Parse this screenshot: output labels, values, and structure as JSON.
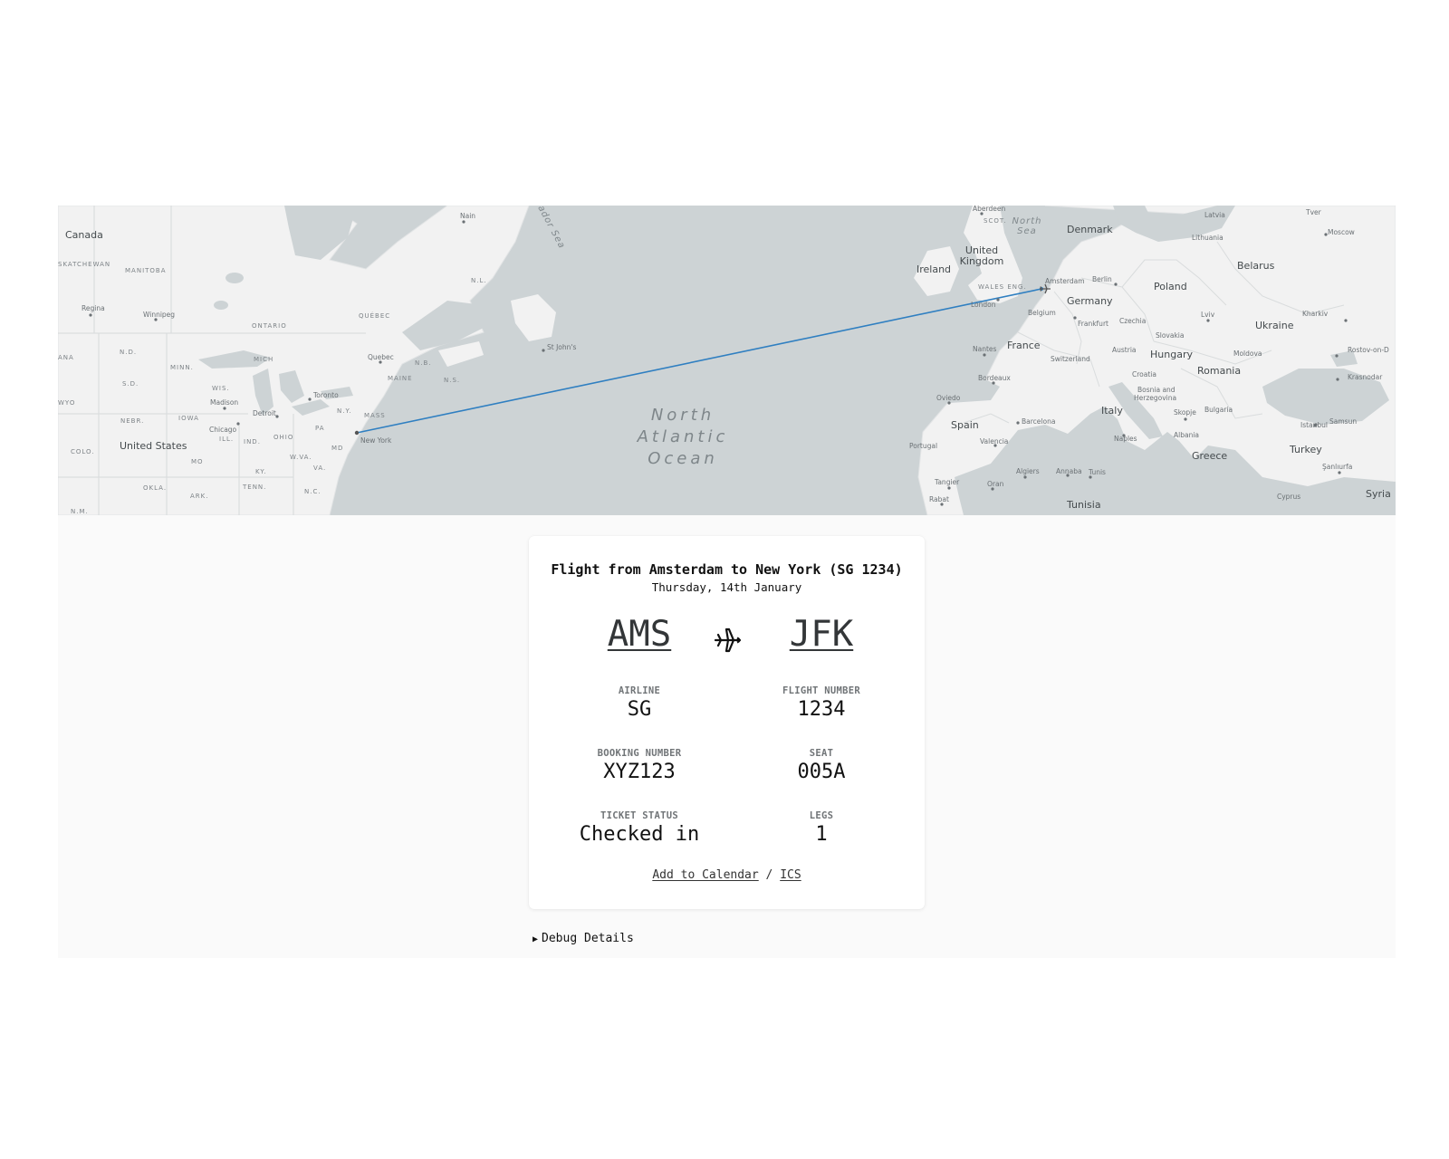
{
  "map": {
    "countries": {
      "canada": "Canada",
      "united_states": "United States",
      "united_kingdom_line1": "United",
      "united_kingdom_line2": "Kingdom",
      "ireland": "Ireland",
      "denmark": "Denmark",
      "latvia": "Latvia",
      "lithuania": "Lithuania",
      "belarus": "Belarus",
      "poland": "Poland",
      "germany": "Germany",
      "belgium": "Belgium",
      "czechia": "Czechia",
      "slovakia": "Slovakia",
      "ukraine": "Ukraine",
      "moldova": "Moldova",
      "france": "France",
      "switzerland": "Switzerland",
      "austria": "Austria",
      "hungary": "Hungary",
      "romania": "Romania",
      "croatia": "Croatia",
      "bosnia_line1": "Bosnia and",
      "bosnia_line2": "Herzegovina",
      "italy": "Italy",
      "bulgaria": "Bulgaria",
      "albania": "Albania",
      "greece": "Greece",
      "turkey": "Turkey",
      "spain": "Spain",
      "portugal": "Portugal",
      "tunisia": "Tunisia",
      "syria": "Syria",
      "cyprus": "Cyprus"
    },
    "regions": {
      "saskatchewan": "SKATCHEWAN",
      "manitoba": "MANITOBA",
      "ontario": "ONTARIO",
      "quebec": "QUÉBEC",
      "nl": "N.L.",
      "nb": "N.B.",
      "ns": "N.S.",
      "maine": "MAINE",
      "nd": "N.D.",
      "minn": "MINN.",
      "sd": "S.D.",
      "wis": "WIS.",
      "mich": "MICH",
      "ny": "N.Y.",
      "mass": "MASS",
      "iowa": "IOWA",
      "nebr": "NEBR.",
      "ill": "ILL.",
      "ind": "IND.",
      "ohio": "OHIO",
      "pa": "PA",
      "colo": "COLO.",
      "mo": "MO",
      "wva": "W.VA.",
      "va": "VA.",
      "ky": "KY.",
      "md": "MD",
      "okla": "OKLA.",
      "ark": "ARK.",
      "tenn": "TENN.",
      "nc": "N.C.",
      "nm": "N.M.",
      "ana": "ANA",
      "wyo": "WYO",
      "scot": "SCOT.",
      "wales_eng": "WALES ENG."
    },
    "cities": {
      "regina": "Regina",
      "winnipeg": "Winnipeg",
      "quebec_city": "Quebec",
      "st_johns": "St John's",
      "nain": "Nain",
      "toronto": "Toronto",
      "madison": "Madison",
      "detroit": "Detroit",
      "chicago": "Chicago",
      "new_york": "New York",
      "aberdeen": "Aberdeen",
      "amsterdam": "Amsterdam",
      "berlin": "Berlin",
      "london": "London",
      "frankfurt": "Frankfurt",
      "moscow": "Moscow",
      "tver": "Tver",
      "kharkiv": "Kharkiv",
      "lviv": "Lviv",
      "rostov": "Rostov-on-D",
      "krasnodar": "Krasnodar",
      "nantes": "Nantes",
      "bordeaux": "Bordeaux",
      "oviedo": "Oviedo",
      "barcelona": "Barcelona",
      "valencia": "Valencia",
      "naples": "Naples",
      "skopje": "Skopje",
      "istanbul": "Istanbul",
      "samsun": "Samsun",
      "sanliurfa": "Şanlıurfa",
      "algiers": "Algiers",
      "annaba": "Annaba",
      "tunis": "Tunis",
      "tangier": "Tangier",
      "oran": "Oran",
      "rabat": "Rabat"
    },
    "seas": {
      "north_sea_line1": "North",
      "north_sea_line2": "Sea",
      "labrador_sea": "ador Sea",
      "ocean_line1": "North",
      "ocean_line2": "Atlantic",
      "ocean_line3": "Ocean"
    },
    "colors": {
      "water": "#cdd3d5",
      "land": "#f2f2f2",
      "route": "#2f7fc1"
    }
  },
  "card": {
    "title": "Flight from Amsterdam to New York (SG 1234)",
    "date": "Thursday, 14th January",
    "origin_code": "AMS",
    "destination_code": "JFK",
    "plane_icon": "airplane-icon",
    "fields": {
      "airline": {
        "label": "AIRLINE",
        "value": "SG"
      },
      "flight_number": {
        "label": "FLIGHT NUMBER",
        "value": "1234"
      },
      "booking_number": {
        "label": "BOOKING NUMBER",
        "value": "XYZ123"
      },
      "seat": {
        "label": "SEAT",
        "value": "005A"
      },
      "ticket_status": {
        "label": "TICKET STATUS",
        "value": "Checked in"
      },
      "legs": {
        "label": "LEGS",
        "value": "1"
      }
    },
    "calendar": {
      "add_label": "Add to Calendar",
      "separator": "/",
      "ics_label": "ICS"
    }
  },
  "debug": {
    "arrow": "▶",
    "label": "Debug Details"
  }
}
